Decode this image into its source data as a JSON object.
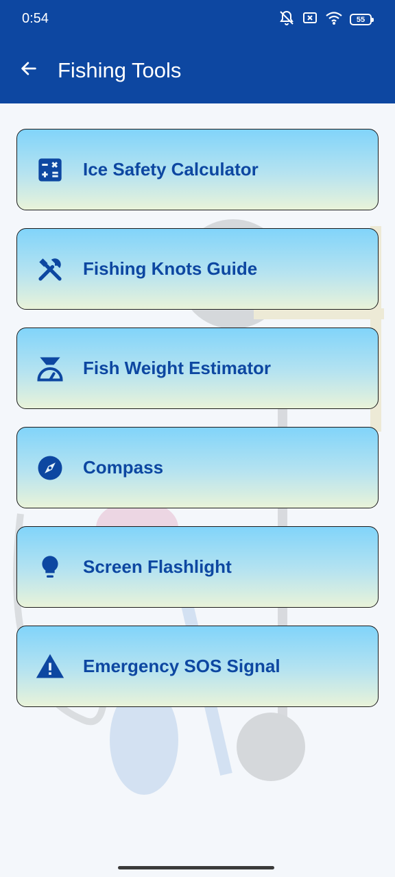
{
  "status_bar": {
    "time": "0:54",
    "battery": "55",
    "icons": [
      "notifications-off-icon",
      "sim-off-icon",
      "wifi-icon",
      "battery-icon"
    ]
  },
  "app_bar": {
    "title": "Fishing Tools",
    "back_icon": "back-arrow-icon"
  },
  "tools": [
    {
      "label": "Ice Safety Calculator",
      "icon": "calculate-icon"
    },
    {
      "label": "Fishing Knots Guide",
      "icon": "tools-icon"
    },
    {
      "label": "Fish Weight Estimator",
      "icon": "scale-icon"
    },
    {
      "label": "Compass",
      "icon": "compass-icon"
    },
    {
      "label": "Screen Flashlight",
      "icon": "lightbulb-icon"
    },
    {
      "label": "Emergency SOS Signal",
      "icon": "warning-icon"
    }
  ],
  "colors": {
    "primary": "#0d47a1",
    "card_top": "#81d4fa",
    "card_bottom": "#e9f3d9",
    "background": "#f4f7fb"
  }
}
